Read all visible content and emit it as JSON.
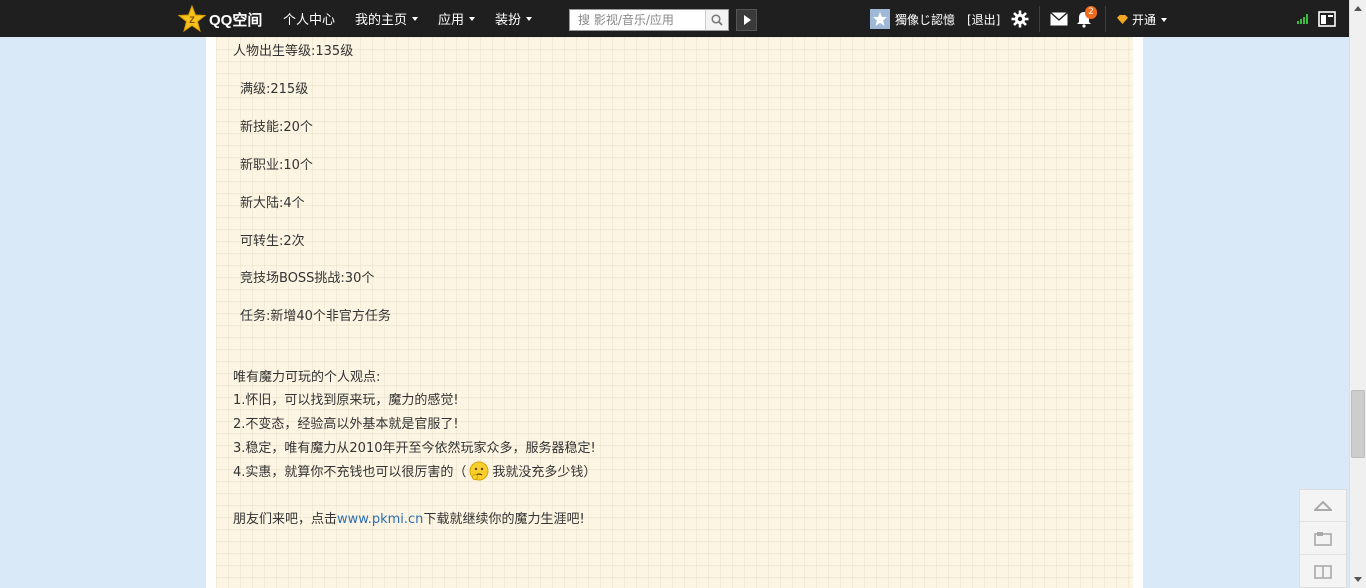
{
  "topbar": {
    "brand": "QQ空间",
    "nav": [
      {
        "label": "个人中心",
        "dropdown": false
      },
      {
        "label": "我的主页",
        "dropdown": true
      },
      {
        "label": "应用",
        "dropdown": true
      },
      {
        "label": "装扮",
        "dropdown": true
      }
    ],
    "search_placeholder": "搜 影视/音乐/应用",
    "username": "獨像じ認憶",
    "logout": "[退出]",
    "notification_count": "2",
    "kaitong": "开通",
    "icons": [
      "settings-gear-icon",
      "mail-icon",
      "notification-bell-icon",
      "signal-icon",
      "compact-view-icon"
    ]
  },
  "content": {
    "stats": [
      "人物出生等级:135级",
      "满级:215级",
      "新技能:20个",
      "新职业:10个",
      "新大陆:4个",
      "可转生:2次",
      "竞技场BOSS挑战:30个",
      "任务:新增40个非官方任务"
    ],
    "opinion_title": "唯有魔力可玩的个人观点:",
    "opinions": [
      "1.怀旧，可以找到原来玩，魔力的感觉!",
      "2.不变态，经验高以外基本就是官服了!",
      "3.稳定，唯有魔力从2010年开至今依然玩家众多，服务器稳定!"
    ],
    "opinion4_before": "4.实惠，就算你不充钱也可以很厉害的（",
    "opinion4_after": "我就没充多少钱）",
    "cta_before": "朋友们来吧，点击",
    "cta_link": "www.pkmi.cn",
    "cta_after": "下载就继续你的魔力生涯吧!"
  },
  "colors": {
    "topbar_bg": "#1f1f1f",
    "page_bg": "#d9e9f8",
    "paper_bg": "#fdf5e3",
    "link": "#2c6fb5",
    "badge": "#f26a1b"
  }
}
